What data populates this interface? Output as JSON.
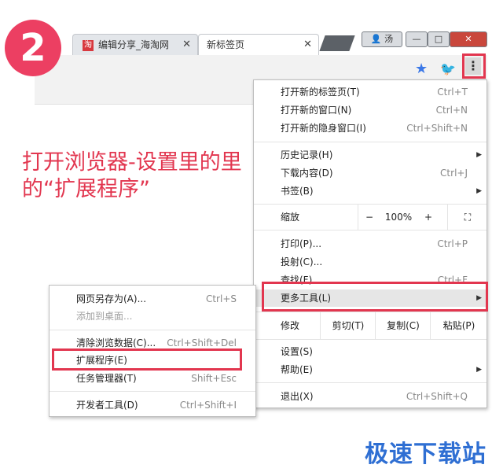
{
  "step": "2",
  "tabs": [
    {
      "icon": "淘",
      "label": "编辑分享_海淘网"
    },
    {
      "label": "新标签页"
    }
  ],
  "window_buttons": {
    "user": "汤",
    "minimize": "—",
    "maximize": "□",
    "close": "✕"
  },
  "instruction": "打开浏览器-设置里的里的“扩展程序”",
  "menu": {
    "new_tab": {
      "label": "打开新的标签页(T)",
      "shortcut": "Ctrl+T"
    },
    "new_window": {
      "label": "打开新的窗口(N)",
      "shortcut": "Ctrl+N"
    },
    "incognito": {
      "label": "打开新的隐身窗口(I)",
      "shortcut": "Ctrl+Shift+N"
    },
    "history": {
      "label": "历史记录(H)"
    },
    "downloads": {
      "label": "下载内容(D)",
      "shortcut": "Ctrl+J"
    },
    "bookmarks": {
      "label": "书签(B)"
    },
    "zoom": {
      "label": "缩放",
      "minus": "−",
      "value": "100%",
      "plus": "+",
      "fullscreen": "⛶"
    },
    "print": {
      "label": "打印(P)...",
      "shortcut": "Ctrl+P"
    },
    "cast": {
      "label": "投射(C)..."
    },
    "find": {
      "label": "查找(F)...",
      "shortcut": "Ctrl+F"
    },
    "more_tools": {
      "label": "更多工具(L)"
    },
    "edit": {
      "label": "修改",
      "cut": "剪切(T)",
      "copy": "复制(C)",
      "paste": "粘贴(P)"
    },
    "settings": {
      "label": "设置(S)"
    },
    "help": {
      "label": "帮助(E)"
    },
    "exit": {
      "label": "退出(X)",
      "shortcut": "Ctrl+Shift+Q"
    }
  },
  "submenu": {
    "save_page": {
      "label": "网页另存为(A)...",
      "shortcut": "Ctrl+S"
    },
    "add_desktop": {
      "label": "添加到桌面..."
    },
    "clear_data": {
      "label": "清除浏览数据(C)...",
      "shortcut": "Ctrl+Shift+Del"
    },
    "extensions": {
      "label": "扩展程序(E)"
    },
    "task_manager": {
      "label": "任务管理器(T)",
      "shortcut": "Shift+Esc"
    },
    "dev_tools": {
      "label": "开发者工具(D)",
      "shortcut": "Ctrl+Shift+I"
    }
  },
  "watermark": "极速下载站",
  "colors": {
    "accent": "#e2364f",
    "badge": "#ec3f62",
    "watermark": "#2f6fd3"
  }
}
